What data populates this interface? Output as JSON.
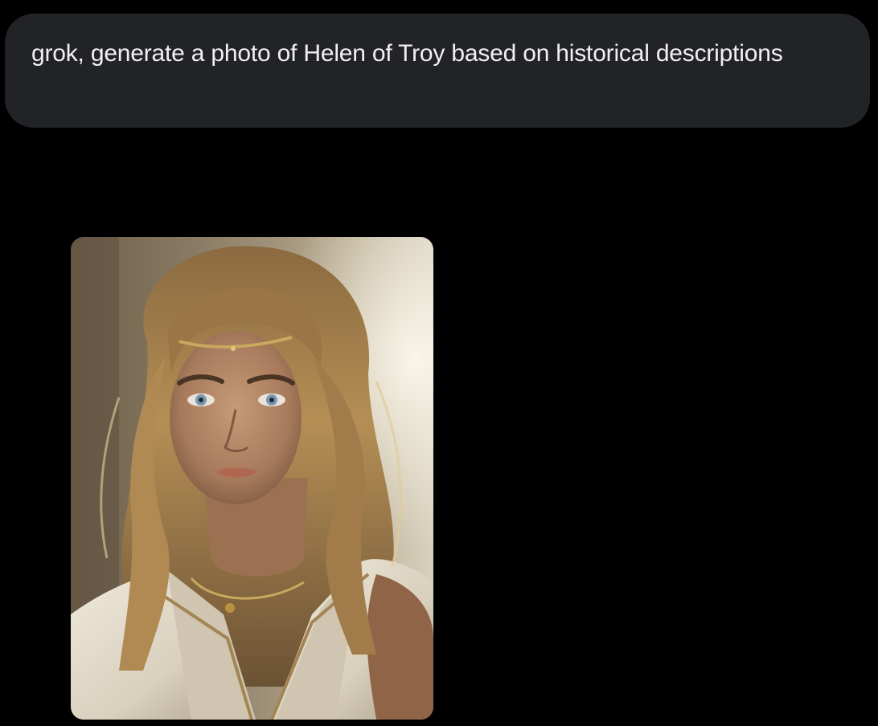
{
  "conversation": {
    "user_message": {
      "text": "grok, generate a photo of Helen of Troy based on historical descriptions"
    },
    "generated_image": {
      "subject": "portrait-photo"
    }
  },
  "colors": {
    "background": "#000000",
    "bubble": "#222327",
    "bubble_text": "#f1f1f3"
  }
}
